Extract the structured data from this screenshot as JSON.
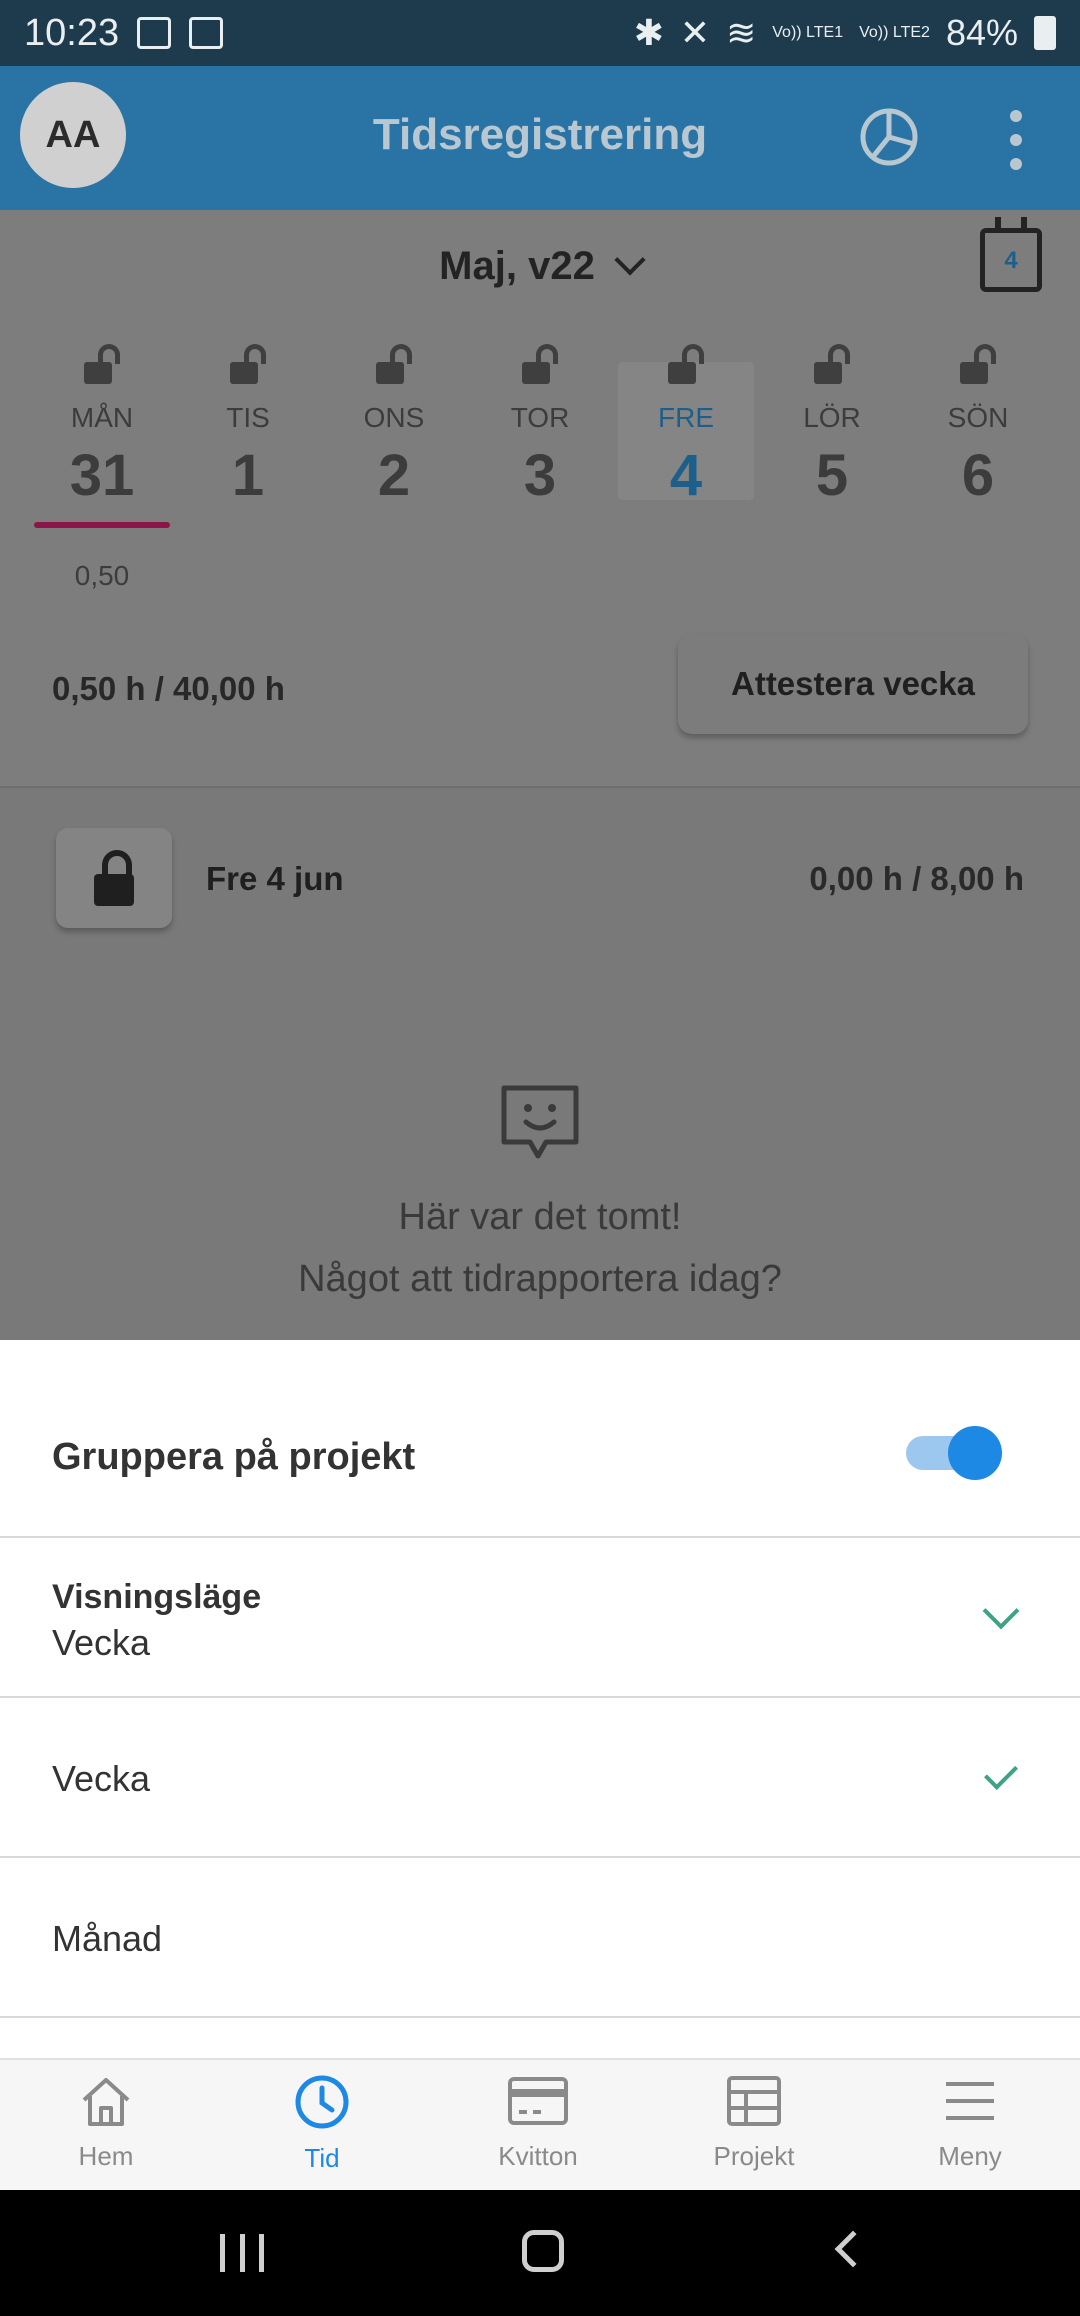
{
  "status_bar": {
    "time": "10:23",
    "sim1": "Vo)) LTE1",
    "sim2": "Vo)) LTE2",
    "battery": "84%"
  },
  "app_bar": {
    "avatar_initials": "AA",
    "title": "Tidsregistrering"
  },
  "week": {
    "selector_label": "Maj, v22",
    "calendar_day": "4",
    "days": [
      {
        "name": "MÅN",
        "num": "31"
      },
      {
        "name": "TIS",
        "num": "1"
      },
      {
        "name": "ONS",
        "num": "2"
      },
      {
        "name": "TOR",
        "num": "3"
      },
      {
        "name": "FRE",
        "num": "4"
      },
      {
        "name": "LÖR",
        "num": "5"
      },
      {
        "name": "SÖN",
        "num": "6"
      }
    ],
    "selected_day_index": 4,
    "monday_hours": "0,50",
    "summary": "0,50 h / 40,00 h",
    "attest_button": "Attestera vecka"
  },
  "day_panel": {
    "date_label": "Fre 4 jun",
    "hours": "0,00 h / 8,00 h",
    "empty_line1": "Här var det tomt!",
    "empty_line2": "Något att tidrapportera idag?"
  },
  "sheet": {
    "group_label": "Gruppera på projekt",
    "group_toggle_on": true,
    "view_mode_label": "Visningsläge",
    "view_mode_value": "Vecka",
    "options": [
      "Vecka",
      "Månad"
    ],
    "selected_option": "Vecka"
  },
  "bottom_nav": {
    "items": [
      {
        "label": "Hem",
        "icon": "home-icon"
      },
      {
        "label": "Tid",
        "icon": "clock-icon"
      },
      {
        "label": "Kvitton",
        "icon": "card-icon"
      },
      {
        "label": "Projekt",
        "icon": "table-icon"
      },
      {
        "label": "Meny",
        "icon": "menu-icon"
      }
    ],
    "active": "Tid"
  },
  "colors": {
    "app_bar": "#2a74a5",
    "accent_blue": "#1e88e5",
    "check_green": "#3da386",
    "underline_magenta": "#8b1547"
  }
}
